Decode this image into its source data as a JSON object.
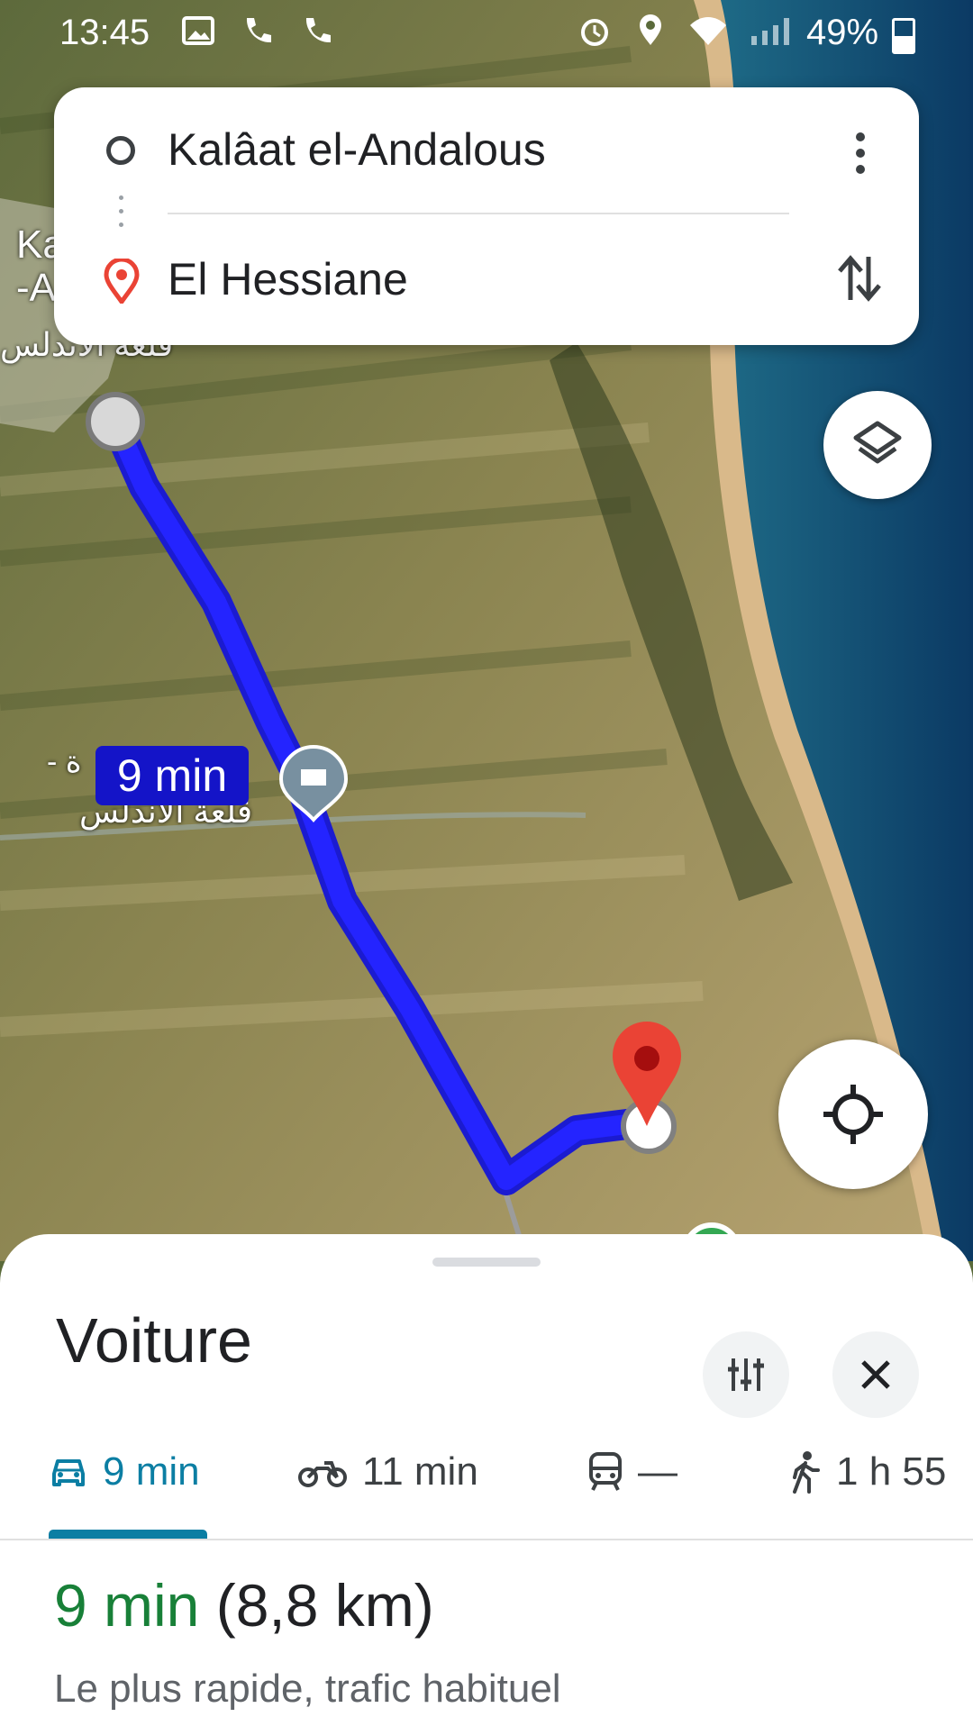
{
  "status_bar": {
    "time": "13:45",
    "battery": "49%"
  },
  "directions": {
    "origin": "Kalâat el-Andalous",
    "destination": "El Hessiane"
  },
  "map": {
    "route_duration_label": "9 min",
    "town_label_line1": "Ka",
    "town_label_line2": "-An",
    "arabic_label_left": "- ة",
    "arabic_label_right": "قلعة الأندلس",
    "arabic_label_top": "قلعة الأندلس"
  },
  "sheet": {
    "mode_title": "Voiture",
    "tabs": [
      {
        "icon": "car-icon",
        "label": "9 min",
        "active": true
      },
      {
        "icon": "motorbike-icon",
        "label": "11 min",
        "active": false
      },
      {
        "icon": "train-icon",
        "label": "—",
        "active": false
      },
      {
        "icon": "walk-icon",
        "label": "1 h 55",
        "active": false
      }
    ],
    "summary_duration": "9 min",
    "summary_distance": "(8,8 km)",
    "summary_note": "Le plus rapide, trafic habituel"
  },
  "colors": {
    "route": "#1a1aff",
    "active_tab": "#0b7ea3",
    "duration_green": "#188038",
    "pin_red": "#ea4335"
  }
}
